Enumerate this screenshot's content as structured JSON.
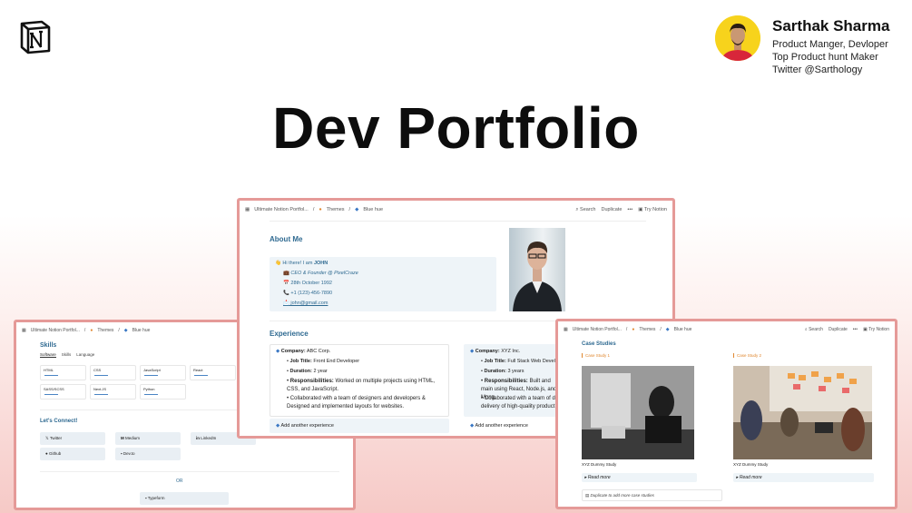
{
  "brand": {
    "logo_icon": "notion-logo-icon"
  },
  "author": {
    "name": "Sarthak Sharma",
    "lines": [
      "Product Manger, Devloper",
      "Top Product hunt Maker",
      "Twitter @Sarthology"
    ]
  },
  "hero_title": "Dev Portfolio",
  "main_card": {
    "breadcrumb": [
      "Ultimate Notion Portfol...",
      "Themes",
      "Blue hue"
    ],
    "actions": {
      "search": "Search",
      "duplicate": "Duplicate",
      "more": "•••",
      "try": "Try Notion"
    },
    "about_heading": "About Me",
    "about_lines": {
      "greeting_prefix": "Hi there! I am ",
      "greeting_name": "JOHN",
      "role": "CEO & Founder @ PixelCraze",
      "dob": "28th October 1992",
      "phone": "+1 (123)-456-7890",
      "email": "john@gmail.com"
    },
    "experience_heading": "Experience",
    "experience": [
      {
        "company_label": "Company:",
        "company": "ABC Corp.",
        "title_label": "Job Title:",
        "title": "Front End Developer",
        "duration_label": "Duration:",
        "duration": "2 year",
        "resp_label": "Responsibilities:",
        "resp": "Worked on multiple projects using HTML, CSS, and JavaScript.",
        "collab": "Collaborated with a team of designers and developers & Designed and implemented layouts for websites."
      },
      {
        "company_label": "Company:",
        "company": "XYZ Inc.",
        "title_label": "Job Title:",
        "title": "Full Stack Web Devel",
        "duration_label": "Duration:",
        "duration": "3 years",
        "resp_label": "Responsibilities:",
        "resp": "Built and main using React, Node.js, and Mong",
        "collab": "Collaborated with a team of dev delivery of high-quality product"
      }
    ],
    "add_experience": "Add another experience"
  },
  "left_card": {
    "breadcrumb": [
      "Ultimate Notion Portfol...",
      "Themes",
      "Blue hue"
    ],
    "skills_heading": "Skills",
    "tabs": [
      "Software",
      "Skills",
      "Language"
    ],
    "skills": [
      "HTML",
      "CSS",
      "JavaScript",
      "React",
      "SASS/SCSS",
      "Next.JS",
      "Python"
    ],
    "connect_heading": "Let's Connect!",
    "links": [
      "Twitter",
      "Medium",
      "LinkedIn",
      "Github",
      "Dev.to"
    ],
    "or_label": "OR",
    "typeform": "Typeform"
  },
  "right_card": {
    "breadcrumb": [
      "Ultimate Notion Portfol...",
      "Themes",
      "Blue hue"
    ],
    "actions": {
      "search": "Search",
      "duplicate": "Duplicate",
      "more": "•••",
      "try": "Try Notion"
    },
    "heading": "Case Studies",
    "cases": [
      {
        "tag": "Case Study 1",
        "caption": "XYZ Dummy Study",
        "read_more": "Read more"
      },
      {
        "tag": "Case Study 2",
        "caption": "XYZ Dummy Study",
        "read_more": "Read more"
      }
    ],
    "add_note": "Duplicate to add more case studies"
  },
  "colors": {
    "accent": "#2f6a91",
    "card_border": "#e59a98",
    "orange_tag": "#e0872f"
  }
}
